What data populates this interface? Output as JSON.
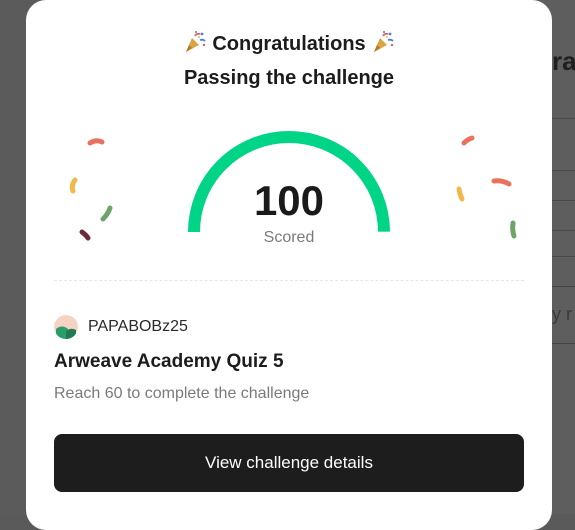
{
  "background": {
    "title_fragment": "ra",
    "text_fragment": "y r"
  },
  "modal": {
    "title": "Congratulations",
    "subtitle": "Passing the challenge",
    "icons": [
      "party-popper-icon"
    ],
    "score": {
      "value": "100",
      "label": "Scored",
      "progress_percent": 100,
      "color": "#00d486"
    },
    "user": {
      "name": "PAPABOBz25"
    },
    "quiz_title": "Arweave Academy Quiz 5",
    "requirement": "Reach 60 to complete the challenge",
    "cta_label": "View challenge details"
  },
  "colors": {
    "accent": "#00d486",
    "button_bg": "#1d1d1d",
    "overlay": "#5b5b5b"
  }
}
